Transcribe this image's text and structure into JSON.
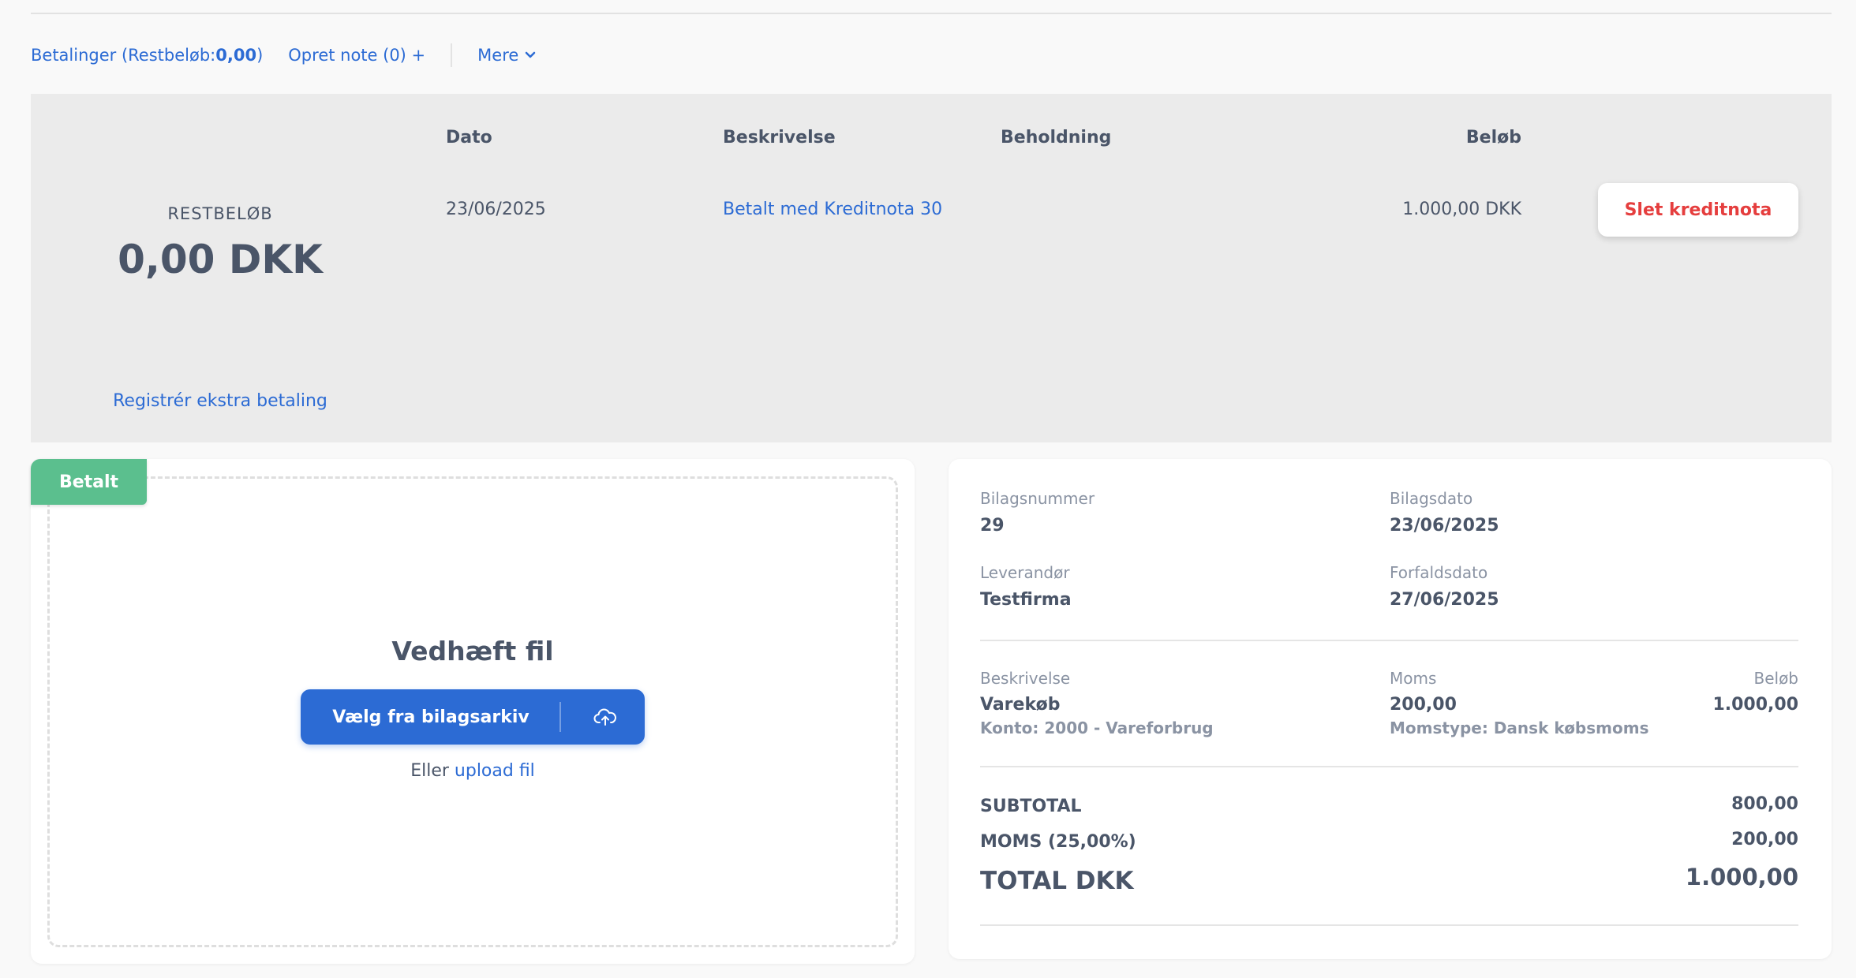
{
  "toolbar": {
    "payments_prefix": "Betalinger (Restbeløb: ",
    "payments_amount": "0,00",
    "payments_suffix": ")",
    "note_label": "Opret note (0) +",
    "more_label": "Mere"
  },
  "payments": {
    "headers": {
      "date": "Dato",
      "description": "Beskrivelse",
      "holding": "Beholdning",
      "amount": "Beløb"
    },
    "rows": [
      {
        "date": "23/06/2025",
        "description": "Betalt med Kreditnota 30",
        "holding": "",
        "amount": "1.000,00 DKK",
        "action": "Slet kreditnota"
      }
    ],
    "remaining_label": "RESTBELØB",
    "remaining_value": "0,00 DKK",
    "extra_payment_label": "Registrér ekstra betaling"
  },
  "attachment": {
    "status_badge": "Betalt",
    "title": "Vedhæft fil",
    "archive_button": "Vælg fra bilagsarkiv",
    "or_prefix": "Eller ",
    "upload_link": "upload fil"
  },
  "voucher": {
    "number_label": "Bilagsnummer",
    "number": "29",
    "date_label": "Bilagsdato",
    "date": "23/06/2025",
    "supplier_label": "Leverandør",
    "supplier": "Testfirma",
    "due_label": "Forfaldsdato",
    "due": "27/06/2025",
    "lines_headers": {
      "description": "Beskrivelse",
      "vat": "Moms",
      "amount": "Beløb"
    },
    "lines": [
      {
        "description": "Varekøb",
        "account": "Konto: 2000 - Vareforbrug",
        "vat": "200,00",
        "vat_type": "Momstype: Dansk købsmoms",
        "amount": "1.000,00"
      }
    ],
    "totals": {
      "subtotal_label": "SUBTOTAL",
      "subtotal": "800,00",
      "vat_label": "MOMS (25,00%)",
      "vat": "200,00",
      "total_label": "TOTAL DKK",
      "total": "1.000,00"
    }
  },
  "colors": {
    "link": "#2c6bd4",
    "danger": "#e53e3e",
    "success": "#5bbf8e",
    "text": "#4a5568",
    "muted": "#8a93a3"
  },
  "icons": {
    "more": "chevron-down-icon",
    "upload": "cloud-upload-icon"
  }
}
